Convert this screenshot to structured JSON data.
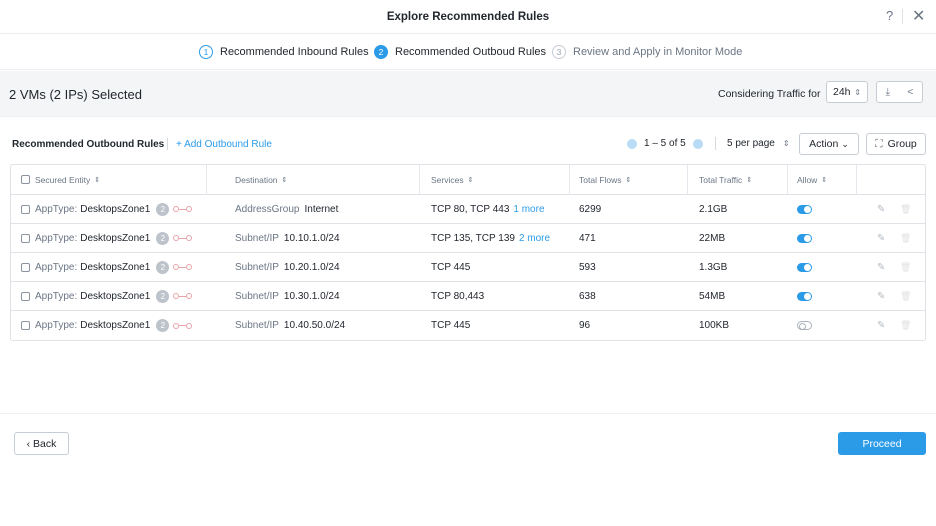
{
  "header": {
    "title": "Explore Recommended Rules",
    "help": "?",
    "close": "✕"
  },
  "steps": [
    {
      "num": "1",
      "label": "Recommended Inbound Rules"
    },
    {
      "num": "2",
      "label": "Recommended Outboud Rules"
    },
    {
      "num": "3",
      "label": "Review and Apply in Monitor Mode"
    }
  ],
  "subbar": {
    "selected": "2 VMs (2 IPs) Selected",
    "considering": "Considering Traffic for",
    "range": "24h",
    "range_caret": "⇕",
    "download": "⤓",
    "share": "<"
  },
  "rules": {
    "title": "Recommended Outbound Rules",
    "add_label": "+ Add Outbound Rule"
  },
  "pagination": {
    "range": "1 – 5 of 5",
    "per_page": "5 per page",
    "per_page_caret": "⇕",
    "action": "Action",
    "action_caret": "⌄",
    "group": "Group",
    "group_icon": "⛶"
  },
  "table": {
    "columns": {
      "entity": "Secured Entity",
      "destination": "Destination",
      "services": "Services",
      "flows": "Total Flows",
      "traffic": "Total Traffic",
      "allow": "Allow"
    },
    "sort_icon": "⇕",
    "rows": [
      {
        "entity_type": "AppType:",
        "entity_name": "DesktopsZone1",
        "badge": "2",
        "dest_type": "AddressGroup",
        "dest_value": "Internet",
        "services": "TCP 80, TCP 443",
        "services_more": "1 more",
        "flows": "6299",
        "traffic": "2.1GB",
        "allow": true
      },
      {
        "entity_type": "AppType:",
        "entity_name": "DesktopsZone1",
        "badge": "2",
        "dest_type": "Subnet/IP",
        "dest_value": "10.10.1.0/24",
        "services": "TCP 135, TCP 139",
        "services_more": "2 more",
        "flows": "471",
        "traffic": "22MB",
        "allow": true
      },
      {
        "entity_type": "AppType:",
        "entity_name": "DesktopsZone1",
        "badge": "2",
        "dest_type": "Subnet/IP",
        "dest_value": "10.20.1.0/24",
        "services": "TCP 445",
        "services_more": "",
        "flows": "593",
        "traffic": "1.3GB",
        "allow": true
      },
      {
        "entity_type": "AppType:",
        "entity_name": "DesktopsZone1",
        "badge": "2",
        "dest_type": "Subnet/IP",
        "dest_value": "10.30.1.0/24",
        "services": "TCP 80,443",
        "services_more": "",
        "flows": "638",
        "traffic": "54MB",
        "allow": true
      },
      {
        "entity_type": "AppType:",
        "entity_name": "DesktopsZone1",
        "badge": "2",
        "dest_type": "Subnet/IP",
        "dest_value": "10.40.50.0/24",
        "services": "TCP 445",
        "services_more": "",
        "flows": "96",
        "traffic": "100KB",
        "allow": false
      }
    ],
    "edit_icon": "✎",
    "delete_icon": "🗑"
  },
  "footer": {
    "back": "‹ Back",
    "proceed": "Proceed"
  },
  "colors": {
    "accent": "#2b9be8",
    "muted": "#6b7685",
    "text": "#22272e"
  }
}
